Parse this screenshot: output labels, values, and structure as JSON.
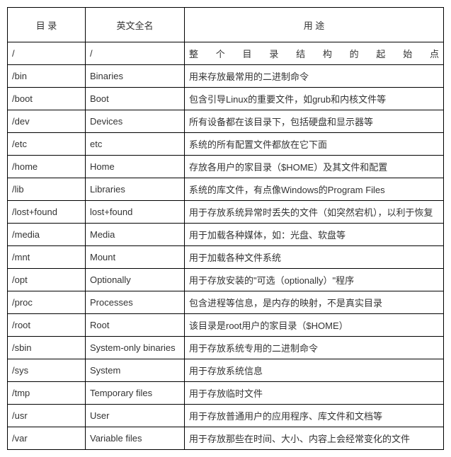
{
  "headers": {
    "c1": "目 录",
    "c2": "英文全名",
    "c3": "用 途"
  },
  "rows": [
    {
      "dir": "/",
      "name": "/",
      "use": "整个目录结构的起始点",
      "justify": true
    },
    {
      "dir": "/bin",
      "name": "Binaries",
      "use": "用来存放最常用的二进制命令"
    },
    {
      "dir": "/boot",
      "name": "Boot",
      "use": "包含引导Linux的重要文件，如grub和内核文件等"
    },
    {
      "dir": "/dev",
      "name": "Devices",
      "use": "所有设备都在该目录下，包括硬盘和显示器等"
    },
    {
      "dir": "/etc",
      "name": "etc",
      "use": "系统的所有配置文件都放在它下面"
    },
    {
      "dir": "/home",
      "name": "Home",
      "use": "存放各用户的家目录（$HOME）及其文件和配置"
    },
    {
      "dir": "/lib",
      "name": "Libraries",
      "use": "系统的库文件，有点像Windows的Program Files"
    },
    {
      "dir": "/lost+found",
      "name": "lost+found",
      "use": "用于存放系统异常时丢失的文件（如突然宕机），以利于恢复"
    },
    {
      "dir": "/media",
      "name": "Media",
      "use": "用于加载各种媒体，如：光盘、软盘等"
    },
    {
      "dir": "/mnt",
      "name": "Mount",
      "use": "用于加载各种文件系统"
    },
    {
      "dir": "/opt",
      "name": "Optionally",
      "use": "用于存放安装的\"可选（optionally）\"程序"
    },
    {
      "dir": "/proc",
      "name": "Processes",
      "use": "包含进程等信息，是内存的映射，不是真实目录"
    },
    {
      "dir": "/root",
      "name": "Root",
      "use": "该目录是root用户的家目录（$HOME）"
    },
    {
      "dir": "/sbin",
      "name": "System-only binaries",
      "use": "用于存放系统专用的二进制命令"
    },
    {
      "dir": "/sys",
      "name": "System",
      "use": "用于存放系统信息"
    },
    {
      "dir": "/tmp",
      "name": "Temporary files",
      "use": "用于存放临时文件"
    },
    {
      "dir": "/usr",
      "name": "User",
      "use": "用于存放普通用户的应用程序、库文件和文档等"
    },
    {
      "dir": "/var",
      "name": "Variable files",
      "use": "用于存放那些在时间、大小、内容上会经常变化的文件"
    }
  ]
}
